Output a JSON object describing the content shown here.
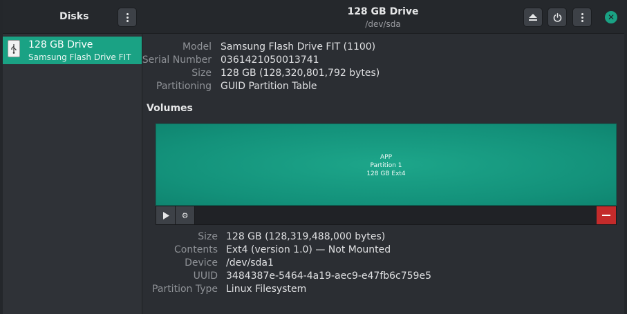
{
  "sidebar": {
    "title": "Disks",
    "items": [
      {
        "name": "128 GB Drive",
        "subtitle": "Samsung Flash Drive FIT",
        "icon": "usb-drive-icon"
      }
    ]
  },
  "header": {
    "title": "128 GB Drive",
    "subtitle": "/dev/sda"
  },
  "drive_info": {
    "model_label": "Model",
    "model_value": "Samsung Flash Drive FIT (1100)",
    "serial_label": "Serial Number",
    "serial_value": "0361421050013741",
    "size_label": "Size",
    "size_value": "128 GB (128,320,801,792 bytes)",
    "partitioning_label": "Partitioning",
    "partitioning_value": "GUID Partition Table"
  },
  "volumes": {
    "title": "Volumes",
    "partition": {
      "name": "APP",
      "number_text": "Partition 1",
      "size_fs": "128 GB Ext4"
    }
  },
  "partition_info": {
    "size_label": "Size",
    "size_value": "128 GB (128,319,488,000 bytes)",
    "contents_label": "Contents",
    "contents_value": "Ext4 (version 1.0) — Not Mounted",
    "device_label": "Device",
    "device_value": "/dev/sda1",
    "uuid_label": "UUID",
    "uuid_value": "3484387e-5464-4a19-aec9-e47fb6c759e5",
    "type_label": "Partition Type",
    "type_value": "Linux Filesystem"
  },
  "colors": {
    "accent": "#1aa284",
    "danger": "#c42b2b",
    "background": "#2b2e33"
  }
}
